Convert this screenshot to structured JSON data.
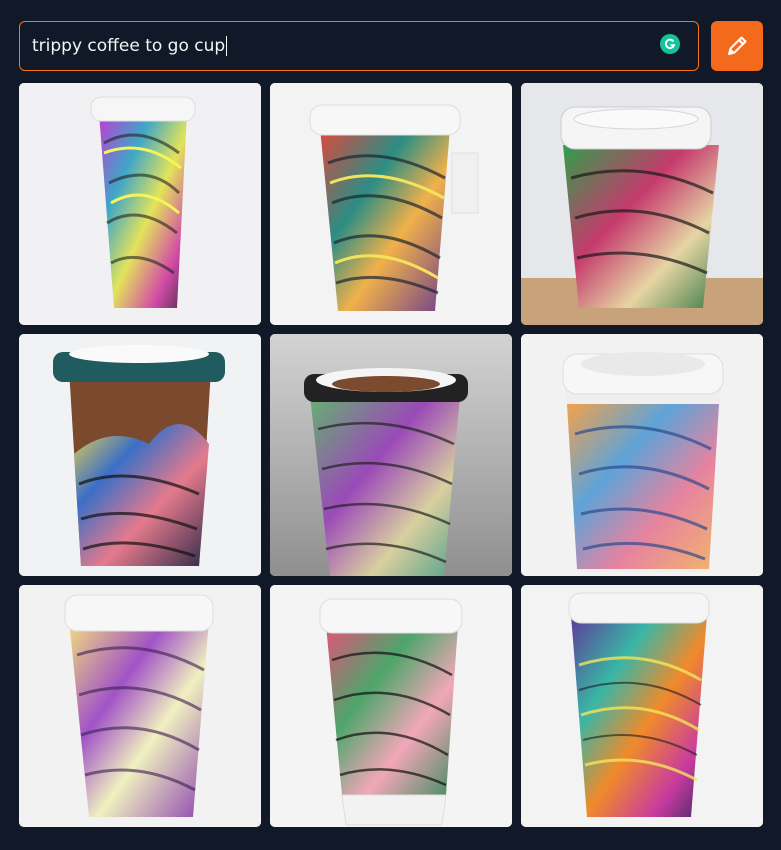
{
  "search": {
    "value": "trippy coffee to go cup",
    "grammarly_icon": "grammarly-icon"
  },
  "draw_button": {
    "icon": "pencil-icon",
    "color": "#f46a1d"
  },
  "colors": {
    "background": "#111827",
    "accent": "#f97316"
  },
  "images": [
    {
      "icon": "coffee-cup-image"
    },
    {
      "icon": "coffee-cup-image"
    },
    {
      "icon": "coffee-cup-image"
    },
    {
      "icon": "coffee-cup-image"
    },
    {
      "icon": "coffee-cup-image"
    },
    {
      "icon": "coffee-cup-image"
    },
    {
      "icon": "coffee-cup-image"
    },
    {
      "icon": "coffee-cup-image"
    },
    {
      "icon": "coffee-cup-image"
    }
  ]
}
